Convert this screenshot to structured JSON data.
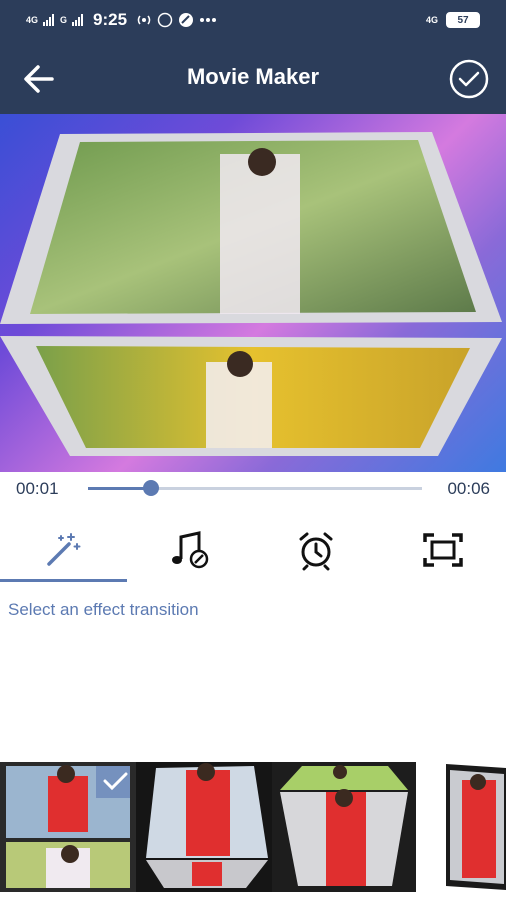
{
  "status": {
    "left_net_1": "4G",
    "left_net_2": "G",
    "time": "9:25",
    "right_net": "4G",
    "battery": "57"
  },
  "header": {
    "title": "Movie Maker"
  },
  "player": {
    "current_time": "00:01",
    "total_time": "00:06",
    "progress": 0.19
  },
  "tools": [
    {
      "name": "effect-transition",
      "icon": "magic-wand-icon",
      "active": true
    },
    {
      "name": "music",
      "icon": "music-note-icon",
      "active": false
    },
    {
      "name": "duration",
      "icon": "alarm-clock-icon",
      "active": false
    },
    {
      "name": "frame",
      "icon": "frame-icon",
      "active": false
    }
  ],
  "hint": "Select an effect transition",
  "colors": {
    "bar": "#2c3d5a",
    "accent": "#5c7ab2"
  }
}
